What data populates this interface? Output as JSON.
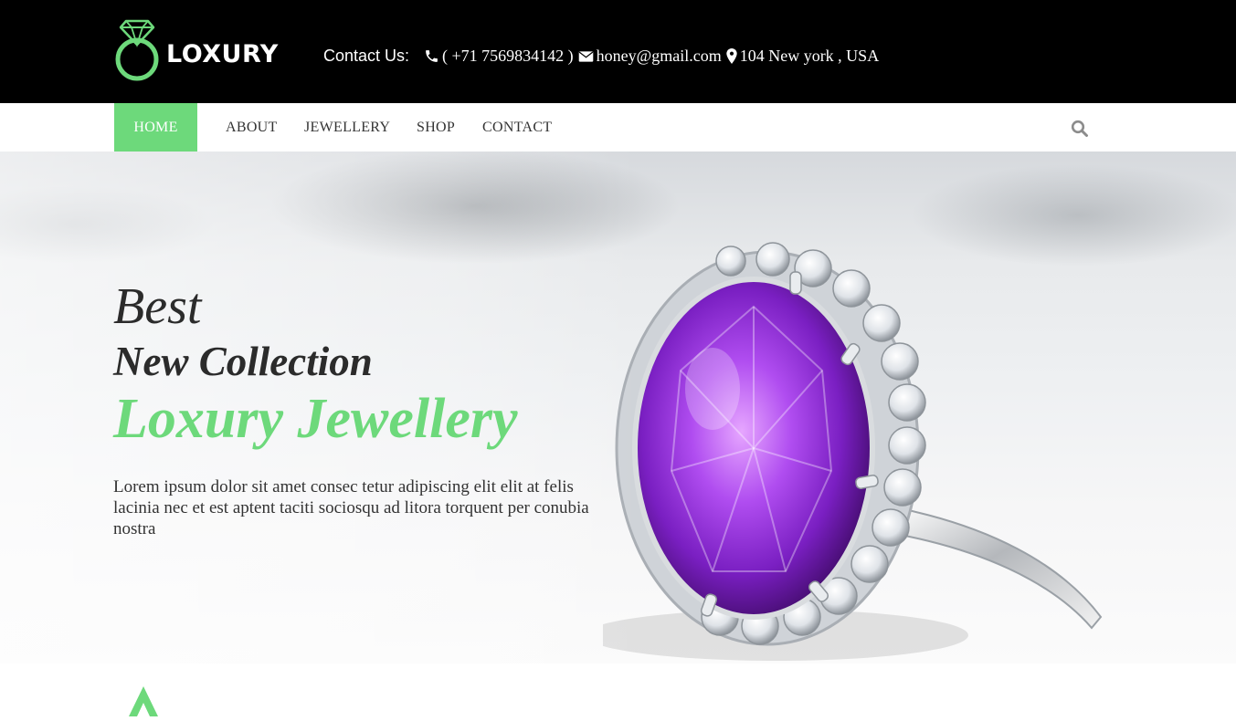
{
  "header": {
    "logo_text": "LOXURY",
    "contact_label": "Contact Us:",
    "phone": "( +71 7569834142 )",
    "email": "honey@gmail.com",
    "address": "104 New york , USA",
    "icons": [
      "phone-icon",
      "envelope-icon",
      "map-marker-icon"
    ]
  },
  "nav": {
    "items": [
      {
        "label": "HOME",
        "active": true
      },
      {
        "label": "ABOUT",
        "active": false
      },
      {
        "label": "JEWELLERY",
        "active": false
      },
      {
        "label": "SHOP",
        "active": false
      },
      {
        "label": "CONTACT",
        "active": false
      }
    ],
    "search_icon": "search-icon"
  },
  "hero": {
    "line1": "Best",
    "line2": "New Collection",
    "line3": "Loxury Jewellery",
    "body": "Lorem ipsum dolor sit amet consec tetur adipiscing elit elit at felis lacinia nec et est aptent taciti sociosqu ad litora torquent per conubia nostra"
  },
  "colors": {
    "accent": "#6dd97b",
    "topbar": "#000000",
    "text_dark": "#2b2b2b",
    "gem": "#8a2bd6"
  }
}
